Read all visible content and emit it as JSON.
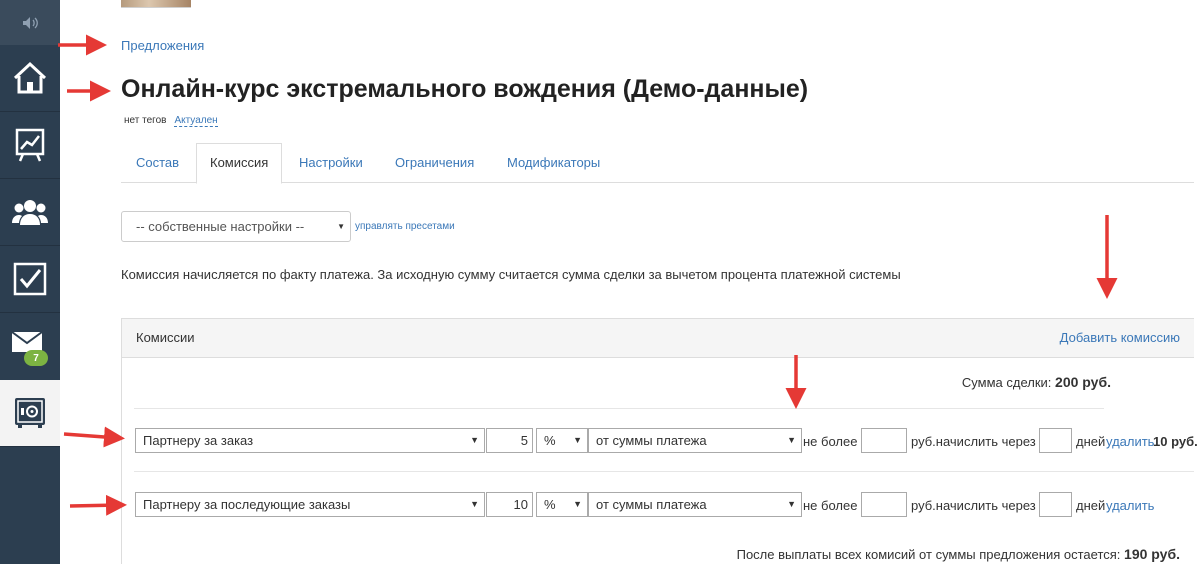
{
  "sidebar": {
    "items": [
      {
        "icon": "home-icon"
      },
      {
        "icon": "chart-icon"
      },
      {
        "icon": "users-icon"
      },
      {
        "icon": "tasks-icon"
      },
      {
        "icon": "mail-icon",
        "badge": "7"
      },
      {
        "icon": "safe-icon"
      }
    ]
  },
  "breadcrumb": "Предложения",
  "title": "Онлайн-курс экстремального вождения (Демо-данные)",
  "tags": {
    "none": "нет тегов",
    "status": "Актуален"
  },
  "tabs": [
    "Состав",
    "Комиссия",
    "Настройки",
    "Ограничения",
    "Модификаторы"
  ],
  "active_tab": "Комиссия",
  "preset": {
    "value": "-- собственные настройки --",
    "manage_link": "управлять пресетами"
  },
  "info_text": "Комиссия начисляется по факту платежа. За исходную сумму считается сумма сделки за вычетом процента платежной системы",
  "panel": {
    "title": "Комиссии",
    "add_link": "Добавить комиссию"
  },
  "deal_sum": {
    "label": "Сумма сделки:",
    "value": "200 руб."
  },
  "rows": [
    {
      "recipient": "Партнеру за заказ",
      "amount": "5",
      "unit": "%",
      "base": "от суммы платежа",
      "not_more": "не более",
      "rub_accrue": "руб.начислить через",
      "days": "дней",
      "delete": "удалить",
      "result": "10 руб."
    },
    {
      "recipient": "Партнеру за последующие заказы",
      "amount": "10",
      "unit": "%",
      "base": "от суммы платежа",
      "not_more": "не более",
      "rub_accrue": "руб.начислить через",
      "days": "дней",
      "delete": "удалить",
      "result": ""
    }
  ],
  "remain": {
    "label": "После выплаты всех комисий от суммы предложения остается:",
    "value": "190 руб."
  },
  "colors": {
    "sidebar": "#2c3e50",
    "link": "#3b78b8",
    "badge": "#7cb342",
    "arrow": "#e53935"
  }
}
